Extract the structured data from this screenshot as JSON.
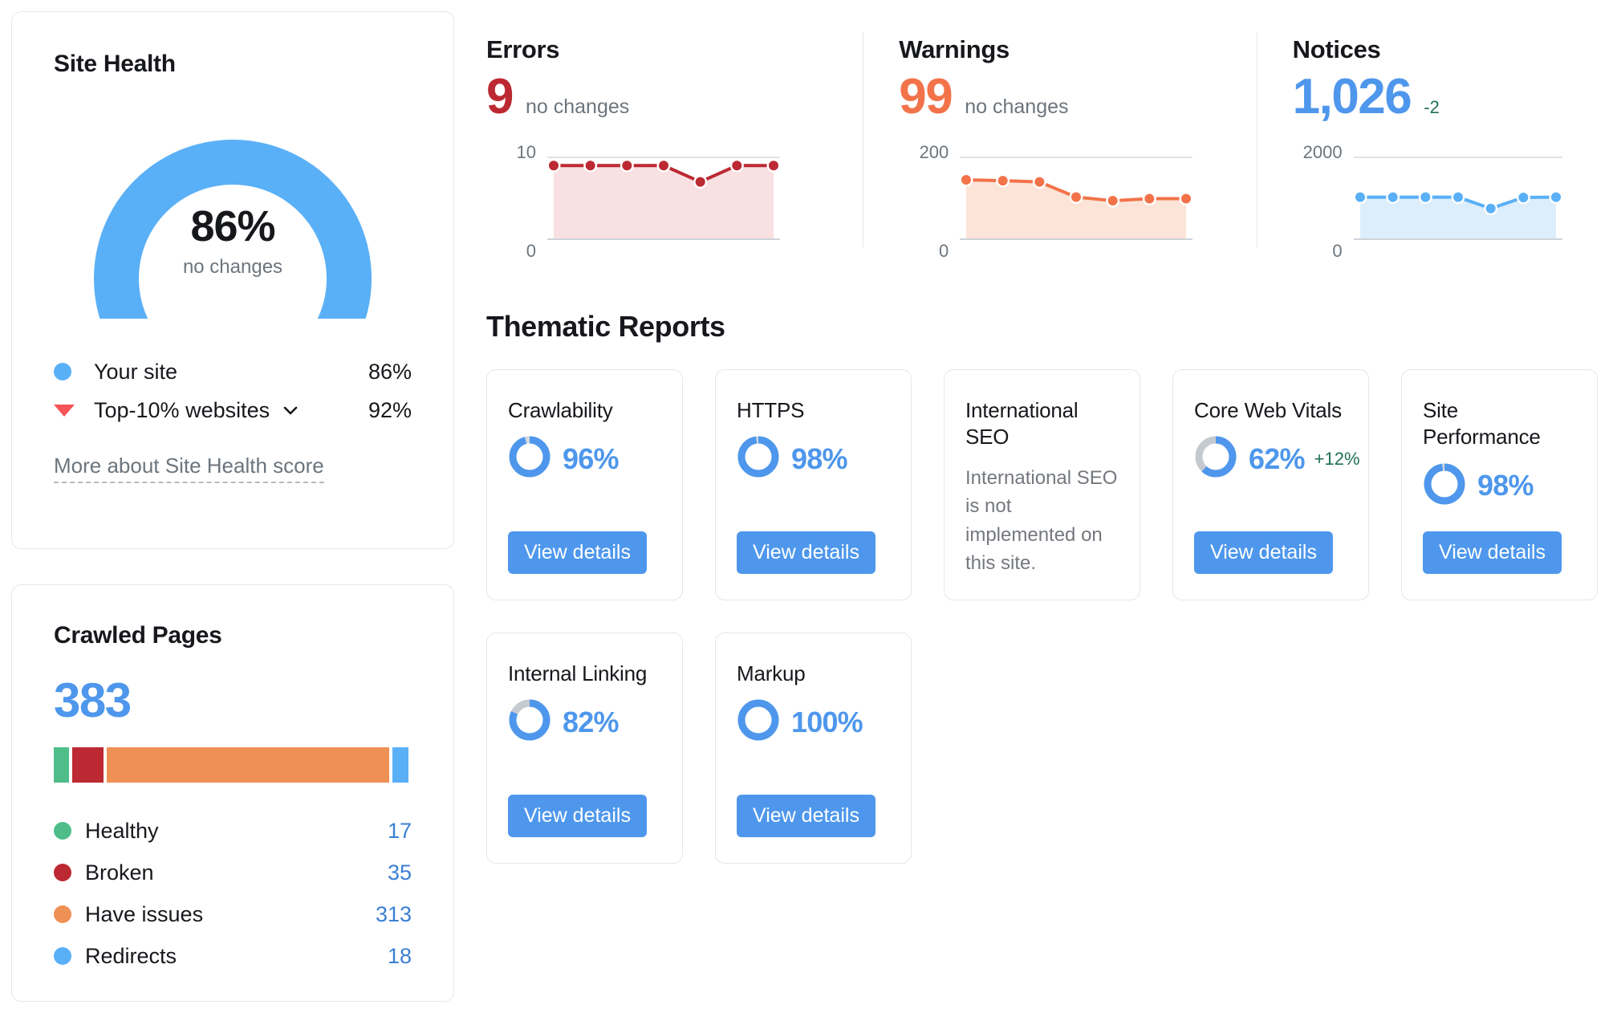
{
  "site_health": {
    "title": "Site Health",
    "score": "86%",
    "score_change": "no changes",
    "legend": [
      {
        "marker": "blue-dot-icon",
        "label": "Your site",
        "value": "86%",
        "has_chevron": false
      },
      {
        "marker": "red-triangle-icon",
        "label": "Top-10% websites",
        "value": "92%",
        "has_chevron": true
      }
    ],
    "more_link": "More about Site Health score",
    "gauge": {
      "your_site_pct": 86,
      "benchmark_pct": 92,
      "your_color": "#5ab0f7",
      "track_color": "#c5cad1",
      "marker_color": "#f45357"
    }
  },
  "crawled_pages": {
    "title": "Crawled Pages",
    "total": "383",
    "breakdown": [
      {
        "label": "Healthy",
        "value": "17",
        "count": 17,
        "color": "#4fbd8a"
      },
      {
        "label": "Broken",
        "value": "35",
        "count": 35,
        "color": "#bc2932"
      },
      {
        "label": "Have issues",
        "value": "313",
        "count": 313,
        "color": "#ef9055"
      },
      {
        "label": "Redirects",
        "value": "18",
        "count": 18,
        "color": "#5ab0f7"
      }
    ]
  },
  "issue_summary": [
    {
      "title": "Errors",
      "count": "9",
      "delta": "no changes",
      "delta_kind": "neutral",
      "color": "#bc2932",
      "fill": "#f9e0e2",
      "axis_top": "10",
      "axis_bottom": "0"
    },
    {
      "title": "Warnings",
      "count": "99",
      "delta": "no changes",
      "delta_kind": "neutral",
      "color": "#f2734a",
      "fill": "#fce4d9",
      "axis_top": "200",
      "axis_bottom": "0"
    },
    {
      "title": "Notices",
      "count": "1,026",
      "delta": "-2",
      "delta_kind": "positive",
      "color": "#5ab0f7",
      "fill": "#dceefb",
      "axis_top": "2000",
      "axis_bottom": "0"
    }
  ],
  "thematic": {
    "title": "Thematic Reports",
    "cards": [
      {
        "title": "Crawlability",
        "percent": "96%",
        "value": 96,
        "change": "",
        "description": "",
        "button": "View details",
        "has_button": true,
        "ring_color": "#4e97ec",
        "track_color": "#d4d9e0"
      },
      {
        "title": "HTTPS",
        "percent": "98%",
        "value": 98,
        "change": "",
        "description": "",
        "button": "View details",
        "has_button": true,
        "ring_color": "#4e97ec",
        "track_color": "#d4d9e0"
      },
      {
        "title": "International SEO",
        "percent": "",
        "value": 0,
        "change": "",
        "description": "International SEO is not implemented on this site.",
        "button": "",
        "has_button": false,
        "ring_color": "#4e97ec",
        "track_color": "#d4d9e0"
      },
      {
        "title": "Core Web Vitals",
        "percent": "62%",
        "value": 62,
        "change": "+12%",
        "description": "",
        "button": "View details",
        "has_button": true,
        "ring_color": "#4e97ec",
        "track_color": "#c5cad1"
      },
      {
        "title": "Site Performance",
        "percent": "98%",
        "value": 98,
        "change": "",
        "description": "",
        "button": "View details",
        "has_button": true,
        "ring_color": "#4e97ec",
        "track_color": "#d4d9e0"
      },
      {
        "title": "Internal Linking",
        "percent": "82%",
        "value": 82,
        "change": "",
        "description": "",
        "button": "View details",
        "has_button": true,
        "ring_color": "#4e97ec",
        "track_color": "#c5cad1"
      },
      {
        "title": "Markup",
        "percent": "100%",
        "value": 100,
        "change": "",
        "description": "",
        "button": "View details",
        "has_button": true,
        "ring_color": "#4e97ec",
        "track_color": "#d4d9e0"
      }
    ]
  },
  "chart_data": [
    {
      "type": "area",
      "title": "Errors",
      "x": [
        1,
        2,
        3,
        4,
        5,
        6,
        7
      ],
      "values": [
        9,
        9,
        9,
        9,
        7,
        9,
        9
      ],
      "ylim": [
        0,
        10
      ],
      "ylabel": "",
      "xlabel": "",
      "tick_labels_y": [
        "0",
        "10"
      ],
      "grid": true,
      "legend": "none",
      "color": "#bc2932",
      "fill": "#f9e0e2"
    },
    {
      "type": "area",
      "title": "Warnings",
      "x": [
        1,
        2,
        3,
        4,
        5,
        6,
        7
      ],
      "values": [
        145,
        143,
        140,
        103,
        94,
        99,
        99
      ],
      "ylim": [
        0,
        200
      ],
      "ylabel": "",
      "xlabel": "",
      "tick_labels_y": [
        "0",
        "200"
      ],
      "grid": true,
      "legend": "none",
      "color": "#f2734a",
      "fill": "#fce4d9"
    },
    {
      "type": "area",
      "title": "Notices",
      "x": [
        1,
        2,
        3,
        4,
        5,
        6,
        7
      ],
      "values": [
        1028,
        1028,
        1028,
        1028,
        750,
        1020,
        1026
      ],
      "ylim": [
        0,
        2000
      ],
      "ylabel": "",
      "xlabel": "",
      "tick_labels_y": [
        "0",
        "2000"
      ],
      "grid": true,
      "legend": "none",
      "color": "#5ab0f7",
      "fill": "#dceefb"
    }
  ]
}
